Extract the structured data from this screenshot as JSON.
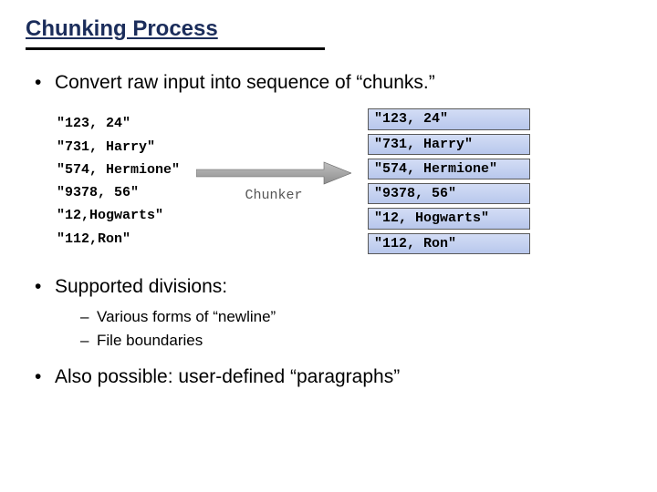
{
  "title": "Chunking Process",
  "bullets": {
    "b1": "Convert raw input into sequence of “chunks.”",
    "b2": "Supported divisions:",
    "b2_sub": {
      "s1": "Various forms of “newline”",
      "s2": "File boundaries"
    },
    "b3": "Also possible: user-defined “paragraphs”"
  },
  "diagram": {
    "raw_lines": {
      "r0": "\"123, 24\"",
      "r1": "\"731, Harry\"",
      "r2": "\"574, Hermione\"",
      "r3": "\"9378, 56\"",
      "r4": "\"12,Hogwarts\"",
      "r5": "\"112,Ron\""
    },
    "chunker_label": "Chunker",
    "chunks": {
      "c0": "\"123, 24\"",
      "c1": "\"731, Harry\"",
      "c2": "\"574, Hermione\"",
      "c3": "\"9378, 56\"",
      "c4": "\"12, Hogwarts\"",
      "c5": "\"112, Ron\""
    }
  }
}
